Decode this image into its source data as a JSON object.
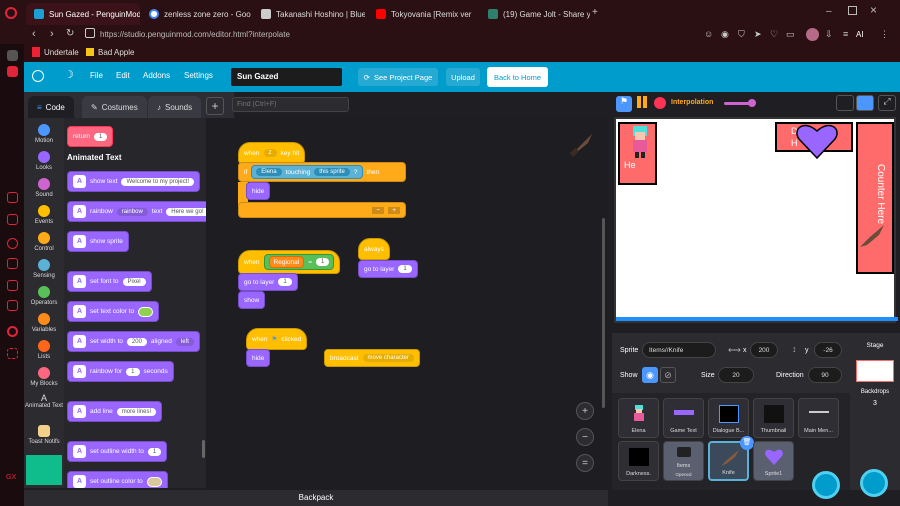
{
  "browser": {
    "tabs": [
      {
        "label": "Sun Gazed - PenguinMod",
        "color": "#1a9fd6",
        "active": true
      },
      {
        "label": "zenless zone zero - Googl",
        "color": "#4285f4",
        "active": false
      },
      {
        "label": "Takanashi Hoshino | Blue",
        "color": "#cccccc",
        "active": false
      },
      {
        "label": "Tokyovania [Remix ver",
        "color": "#ff0000",
        "active": false
      },
      {
        "label": "(19) Game Jolt - Share you",
        "color": "#2f7f6f",
        "active": false
      }
    ],
    "new_tab": "+",
    "url": "https://studio.penguinmod.com/editor.html?interpolate",
    "bookmarks": [
      {
        "label": "Undertale"
      },
      {
        "label": "Bad Apple"
      }
    ],
    "ai_label": "AI"
  },
  "menubar": {
    "file": "File",
    "edit": "Edit",
    "addons": "Addons",
    "settings": "Settings",
    "project_title": "Sun Gazed",
    "see_project": "See Project Page",
    "upload": "Upload",
    "back_home": "Back to Home"
  },
  "editor_tabs": {
    "code": "Code",
    "costumes": "Costumes",
    "sounds": "Sounds"
  },
  "find_placeholder": "Find (Ctrl+F)",
  "categories": [
    {
      "label": "Motion",
      "color": "#4c97ff"
    },
    {
      "label": "Looks",
      "color": "#9966ff"
    },
    {
      "label": "Sound",
      "color": "#cf63cf"
    },
    {
      "label": "Events",
      "color": "#ffbf00"
    },
    {
      "label": "Control",
      "color": "#ffab19"
    },
    {
      "label": "Sensing",
      "color": "#5cb1d6"
    },
    {
      "label": "Operators",
      "color": "#59c059"
    },
    {
      "label": "Variables",
      "color": "#ff8c1a"
    },
    {
      "label": "Lists",
      "color": "#ff661a"
    },
    {
      "label": "My Blocks",
      "color": "#ff6680"
    },
    {
      "label": "Animated Text",
      "color": "#ffffff"
    },
    {
      "label": "Toast Notifs",
      "color": "#f4d08b"
    }
  ],
  "palette": {
    "return_label": "return",
    "return_value": "1",
    "section_title": "Animated Text",
    "blocks": {
      "show_text": "show text",
      "show_text_val": "Welcome to my project!",
      "rainbow": "rainbow",
      "rainbow_dd": "rainbow",
      "rainbow_text": "text",
      "rainbow_val": "Here we go!",
      "show_sprite": "show sprite",
      "set_font": "set font to",
      "font_val": "Pixel",
      "set_color": "set text color to",
      "set_width": "set width to",
      "width_val": "200",
      "aligned": "aligned",
      "align_val": "left",
      "rainbow_for": "rainbow for",
      "rainbow_for_val": "1",
      "seconds": "seconds",
      "add_line": "add line",
      "add_line_val": "more lines!",
      "outline_width": "set outline width to",
      "outline_width_val": "1",
      "outline_color": "set outline color to"
    }
  },
  "scripts": {
    "s1_when": "when",
    "s1_key": "z",
    "s1_keyhit": "key hit",
    "s1_if": "if",
    "s1_sprite": "Elena",
    "s1_touching": "touching",
    "s1_obj": "this sprite",
    "s1_q": "?",
    "s1_then": "then",
    "s1_hide": "hide",
    "s1_minus": "−",
    "s1_plus": "+",
    "s2_when": "when",
    "s2_var": "Regional",
    "s2_eq": "=",
    "s2_val": "1",
    "s2_goto": "go to layer",
    "s2_goto_val": "1",
    "s2_show": "show",
    "s3_always": "always",
    "s3_goto": "go to layer",
    "s3_goto_val": "1",
    "s4_when": "when",
    "s4_clicked": "clicked",
    "s4_hide": "hide",
    "s5_broadcast": "broadcast",
    "s5_msg": "move character"
  },
  "backpack": "Backpack",
  "stage_controls": {
    "interpolation": "Interpolation"
  },
  "stage_text": {
    "counter": "Counter Here",
    "he": "He",
    "dial_d": "D",
    "dial_h": "H"
  },
  "sprite_info": {
    "sprite_label": "Sprite",
    "sprite_name": "Items//Knife",
    "x_label": "x",
    "x": "200",
    "y_label": "y",
    "y": "-26",
    "show_label": "Show",
    "size_label": "Size",
    "size": "20",
    "direction_label": "Direction",
    "direction": "90"
  },
  "sprites": [
    {
      "label": "Elena"
    },
    {
      "label": "Game Text"
    },
    {
      "label": "Dialogue B..."
    },
    {
      "label": "Thumbnail"
    },
    {
      "label": "Main Men..."
    },
    {
      "label": "Darkness."
    },
    {
      "label": "Items",
      "sub": "Opened"
    },
    {
      "label": "Knife"
    },
    {
      "label": "Sprite1"
    }
  ],
  "stage_panel": {
    "title": "Stage",
    "backdrops_label": "Backdrops",
    "backdrops_count": "3"
  }
}
